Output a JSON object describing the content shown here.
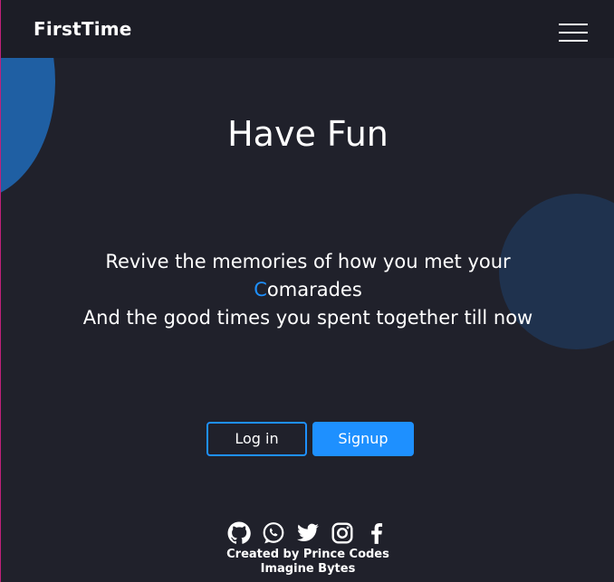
{
  "navbar": {
    "brand": "FirstTime",
    "menu_icon": "hamburger-menu-icon"
  },
  "hero": {
    "title": "Have Fun",
    "line1": "Revive the memories of how you met your",
    "line2_first": "C",
    "line2_rest": "omarades",
    "line3": "And the good times you spent together till now"
  },
  "actions": {
    "login_label": "Log in",
    "signup_label": "Signup"
  },
  "social": {
    "icons": [
      "github-icon",
      "whatsapp-icon",
      "twitter-icon",
      "instagram-icon",
      "facebook-icon"
    ]
  },
  "footer": {
    "credit_line1": "Created by Prince Codes",
    "credit_line2": "Imagine Bytes"
  },
  "colors": {
    "background": "#20212b",
    "navbar": "#1c1d26",
    "accent": "#1e90ff",
    "blob_left": "#1f5fa3",
    "blob_right": "#1f324e"
  }
}
